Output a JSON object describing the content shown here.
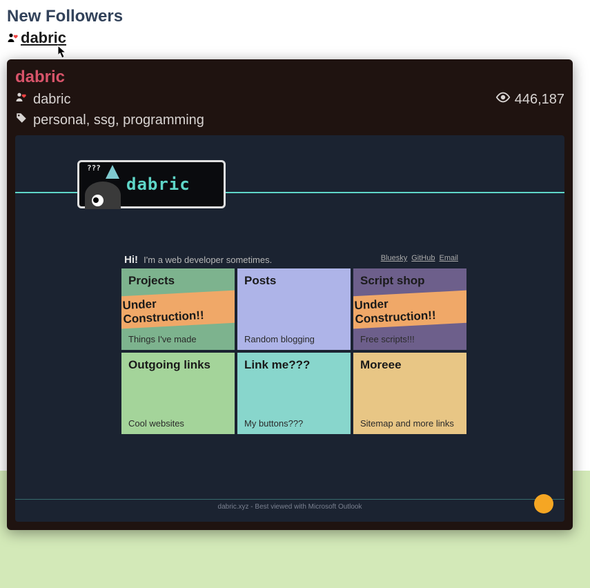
{
  "section": {
    "title": "New Followers",
    "follower_name": "dabric"
  },
  "popup": {
    "title": "dabric",
    "username": "dabric",
    "views": "446,187",
    "tags": "personal, ssg, programming"
  },
  "preview": {
    "badge_name": "dabric",
    "greeting": "Hi!",
    "tagline": "I'm a web developer sometimes.",
    "links": [
      "Bluesky",
      "GitHub",
      "Email"
    ],
    "cards": [
      {
        "title": "Projects",
        "sub": "Things I've made",
        "banner": "Under Construction!!"
      },
      {
        "title": "Posts",
        "sub": "Random blogging",
        "banner": ""
      },
      {
        "title": "Script shop",
        "sub": "Free scripts!!!",
        "banner": "Under Construction!!"
      },
      {
        "title": "Outgoing links",
        "sub": "Cool websites",
        "banner": ""
      },
      {
        "title": "Link me???",
        "sub": "My buttons???",
        "banner": ""
      },
      {
        "title": "Moreee",
        "sub": "Sitemap and more links",
        "banner": ""
      }
    ],
    "footer": "dabric.xyz - Best viewed with Microsoft Outlook"
  }
}
